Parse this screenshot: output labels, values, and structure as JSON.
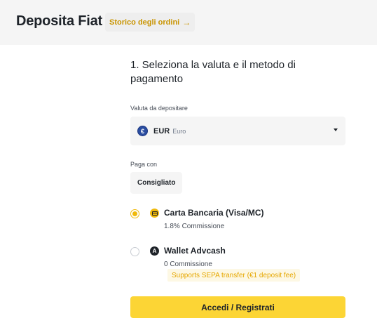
{
  "header": {
    "title": "Deposita Fiat",
    "history_label": "Storico degli ordini",
    "history_arrow": "→"
  },
  "step": {
    "title": "1. Seleziona la valuta e il metodo di pagamento"
  },
  "currency": {
    "label": "Valuta da depositare",
    "icon_glyph": "€",
    "code": "EUR",
    "name": "Euro"
  },
  "payment": {
    "label": "Paga con",
    "tab_label": "Consigliato",
    "methods": [
      {
        "name": "Carta Bancaria (Visa/MC)",
        "fee": "1.8% Commissione",
        "selected": true,
        "icon": "card-icon"
      },
      {
        "name": "Wallet Advcash",
        "fee": "0 Commissione",
        "selected": false,
        "icon": "advcash-icon",
        "icon_glyph": "A",
        "badge": "Supports SEPA transfer (€1 deposit fee)"
      }
    ]
  },
  "cta": {
    "label": "Accedi / Registrati"
  },
  "colors": {
    "accent": "#f0b90b",
    "button": "#fcd535",
    "link": "#c99400"
  }
}
